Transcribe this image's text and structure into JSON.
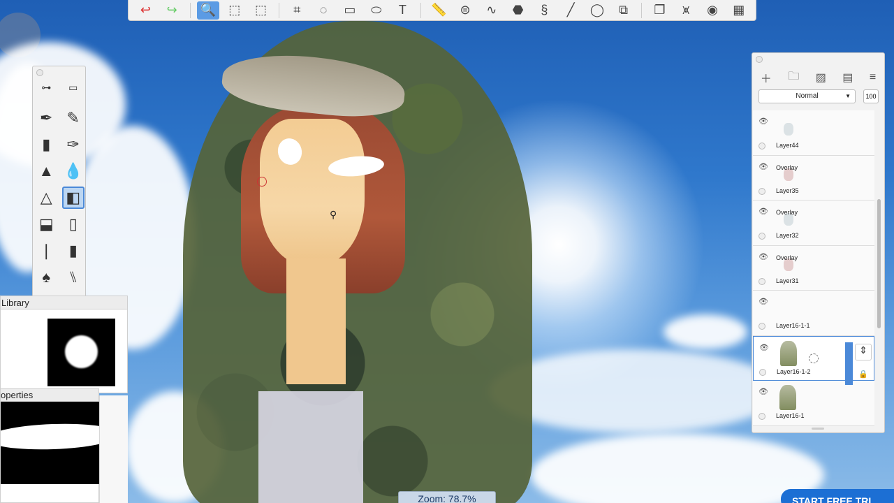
{
  "toolbar": {
    "tools": [
      {
        "icon": "undo-icon",
        "glyph": "↩"
      },
      {
        "icon": "redo-icon",
        "glyph": "↪"
      },
      {
        "icon": "zoom-icon",
        "glyph": "🔍",
        "active": true
      },
      {
        "icon": "select-icon",
        "glyph": "⬚"
      },
      {
        "icon": "lasso-select-icon",
        "glyph": "⬚"
      },
      {
        "icon": "crop-icon",
        "glyph": "⌗"
      },
      {
        "icon": "transform-icon",
        "glyph": "◌"
      },
      {
        "icon": "distort-icon",
        "glyph": "▭"
      },
      {
        "icon": "fill-bucket-icon",
        "glyph": "⬭"
      },
      {
        "icon": "text-icon",
        "glyph": "T"
      },
      {
        "icon": "ruler-icon",
        "glyph": "📏"
      },
      {
        "icon": "symmetry-icon",
        "glyph": "⊜"
      },
      {
        "icon": "curve-icon",
        "glyph": "∿"
      },
      {
        "icon": "perspective-grid-icon",
        "glyph": "⬣"
      },
      {
        "icon": "steady-stroke-icon",
        "glyph": "§"
      },
      {
        "icon": "line-icon",
        "glyph": "╱"
      },
      {
        "icon": "ellipse-icon",
        "glyph": "◯"
      },
      {
        "icon": "shape-icon",
        "glyph": "⧉"
      },
      {
        "icon": "copy-layers-icon",
        "glyph": "❐"
      },
      {
        "icon": "brush-library-icon",
        "glyph": "⩙"
      },
      {
        "icon": "color-wheel-icon",
        "glyph": "◉"
      },
      {
        "icon": "color-swatches-icon",
        "glyph": "▦"
      }
    ]
  },
  "brush_palette": {
    "rows": [
      [
        "sliders-icon",
        "brush-panel-icon"
      ],
      [
        "pen-brush-icon",
        "pencil-brush-icon"
      ],
      [
        "marker-brush-icon",
        "ink-brush-icon"
      ],
      [
        "airbrush-icon",
        "smudge-brush-icon"
      ],
      [
        "wedge-brush-icon",
        "eraser-brush-icon"
      ],
      [
        "blender-brush-icon",
        "lipstick-brush-icon"
      ],
      [
        "paint-brush-icon",
        "chisel-brush-icon"
      ],
      [
        "fan-brush-icon",
        "flat-brush-icon"
      ]
    ]
  },
  "library": {
    "title": "Library"
  },
  "properties": {
    "title": "operties"
  },
  "zoom": {
    "label": "Zoom: 78.7%"
  },
  "layers_panel": {
    "blend_mode": "Normal",
    "opacity": "100",
    "layers": [
      {
        "name": "Layer44",
        "blend": "",
        "thumb": "sketch",
        "selected": false
      },
      {
        "name": "Layer35",
        "blend": "Overlay",
        "thumb": "mark",
        "selected": false
      },
      {
        "name": "Layer32",
        "blend": "Overlay",
        "thumb": "sketch",
        "selected": false
      },
      {
        "name": "Layer31",
        "blend": "Overlay",
        "thumb": "mark",
        "selected": false
      },
      {
        "name": "Layer16-1-1",
        "blend": "",
        "thumb": "none",
        "selected": false
      },
      {
        "name": "Layer16-1-2",
        "blend": "",
        "thumb": "hood",
        "selected": true
      },
      {
        "name": "Layer16-1",
        "blend": "",
        "thumb": "hood",
        "selected": false
      }
    ]
  },
  "banner": {
    "label": "START FREE TRI"
  },
  "colors": {
    "accent": "#4b89d8",
    "banner": "#1c6fd4",
    "sky": "#2f78cc"
  }
}
